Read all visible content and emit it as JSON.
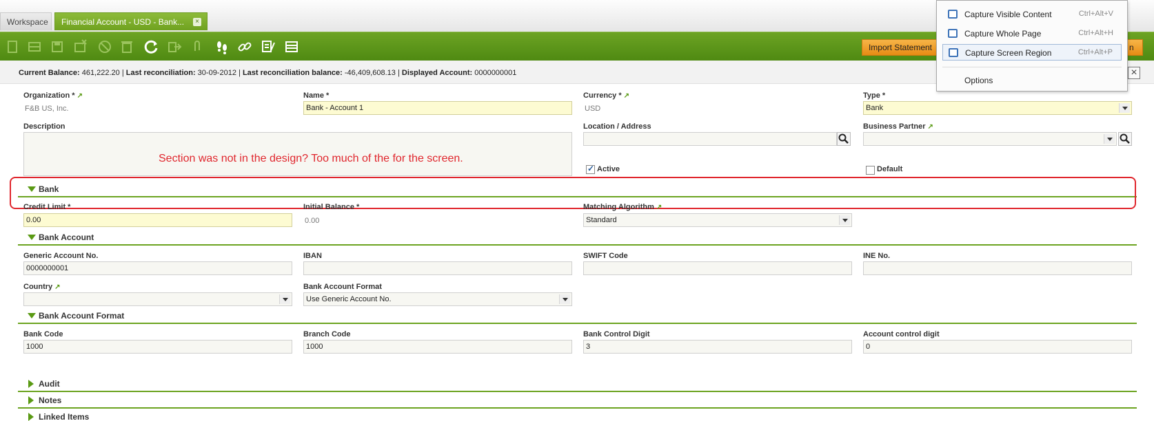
{
  "tabs": {
    "workspace": "Workspace",
    "active": "Financial Account - USD - Bank...",
    "close": "×"
  },
  "toolbar": {
    "icons": [
      "new-doc-icon",
      "grid-view-icon",
      "save-icon",
      "save-close-icon",
      "undo-icon",
      "delete-icon",
      "refresh-icon",
      "export-icon",
      "attachment-icon",
      "footprints-icon",
      "link-icon",
      "tools-icon",
      "form-toggle-icon"
    ],
    "import_label": "Import Statement",
    "import_label2": "n"
  },
  "status": {
    "current_balance_label": "Current Balance:",
    "current_balance": "461,222.20",
    "last_reconciliation_label": "Last reconciliation:",
    "last_reconciliation": "30-09-2012",
    "last_reconciliation_balance_label": "Last reconciliation balance:",
    "last_reconciliation_balance": "-46,409,608.13",
    "displayed_account_label": "Displayed Account:",
    "displayed_account": "0000000001",
    "sep": "|"
  },
  "form": {
    "organization_label": "Organization *",
    "organization_value": "F&B US, Inc.",
    "name_label": "Name *",
    "name_value": "Bank - Account 1",
    "currency_label": "Currency *",
    "currency_value": "USD",
    "type_label": "Type *",
    "type_value": "Bank",
    "description_label": "Description",
    "location_label": "Location / Address",
    "business_partner_label": "Business Partner",
    "active_label": "Active",
    "active_checked": true,
    "default_label": "Default",
    "default_checked": false,
    "link_glyph": "↗"
  },
  "annotation": {
    "text": "Section was not in the design? Too much of the for the screen."
  },
  "sections": {
    "bank": "Bank",
    "bank_account": "Bank Account",
    "bank_account_format": "Bank Account Format",
    "audit": "Audit",
    "notes": "Notes",
    "linked_items": "Linked Items"
  },
  "bank": {
    "credit_limit_label": "Credit Limit *",
    "credit_limit_value": "0.00",
    "initial_balance_label": "Initial Balance *",
    "initial_balance_value": "0.00",
    "matching_algorithm_label": "Matching Algorithm",
    "matching_algorithm_value": "Standard"
  },
  "bank_account": {
    "generic_account_label": "Generic Account No.",
    "generic_account_value": "0000000001",
    "iban_label": "IBAN",
    "iban_value": "",
    "swift_label": "SWIFT Code",
    "swift_value": "",
    "ine_label": "INE No.",
    "ine_value": "",
    "country_label": "Country",
    "country_value": "",
    "format_label": "Bank Account Format",
    "format_value": "Use Generic Account No."
  },
  "bank_account_format": {
    "bank_code_label": "Bank Code",
    "bank_code_value": "1000",
    "branch_code_label": "Branch Code",
    "branch_code_value": "1000",
    "control_digit_label": "Bank Control Digit",
    "control_digit_value": "3",
    "account_control_label": "Account control digit",
    "account_control_value": "0"
  },
  "popup": {
    "items": [
      {
        "label": "Capture Visible Content",
        "shortcut": "Ctrl+Alt+V"
      },
      {
        "label": "Capture Whole Page",
        "shortcut": "Ctrl+Alt+H"
      },
      {
        "label": "Capture Screen Region",
        "shortcut": "Ctrl+Alt+P"
      }
    ],
    "options": "Options"
  },
  "colors": {
    "brand_green": "#6ca323",
    "annotation_red": "#e0262d",
    "required_yellow": "#fdfbd2",
    "import_orange": "#f0a030"
  }
}
